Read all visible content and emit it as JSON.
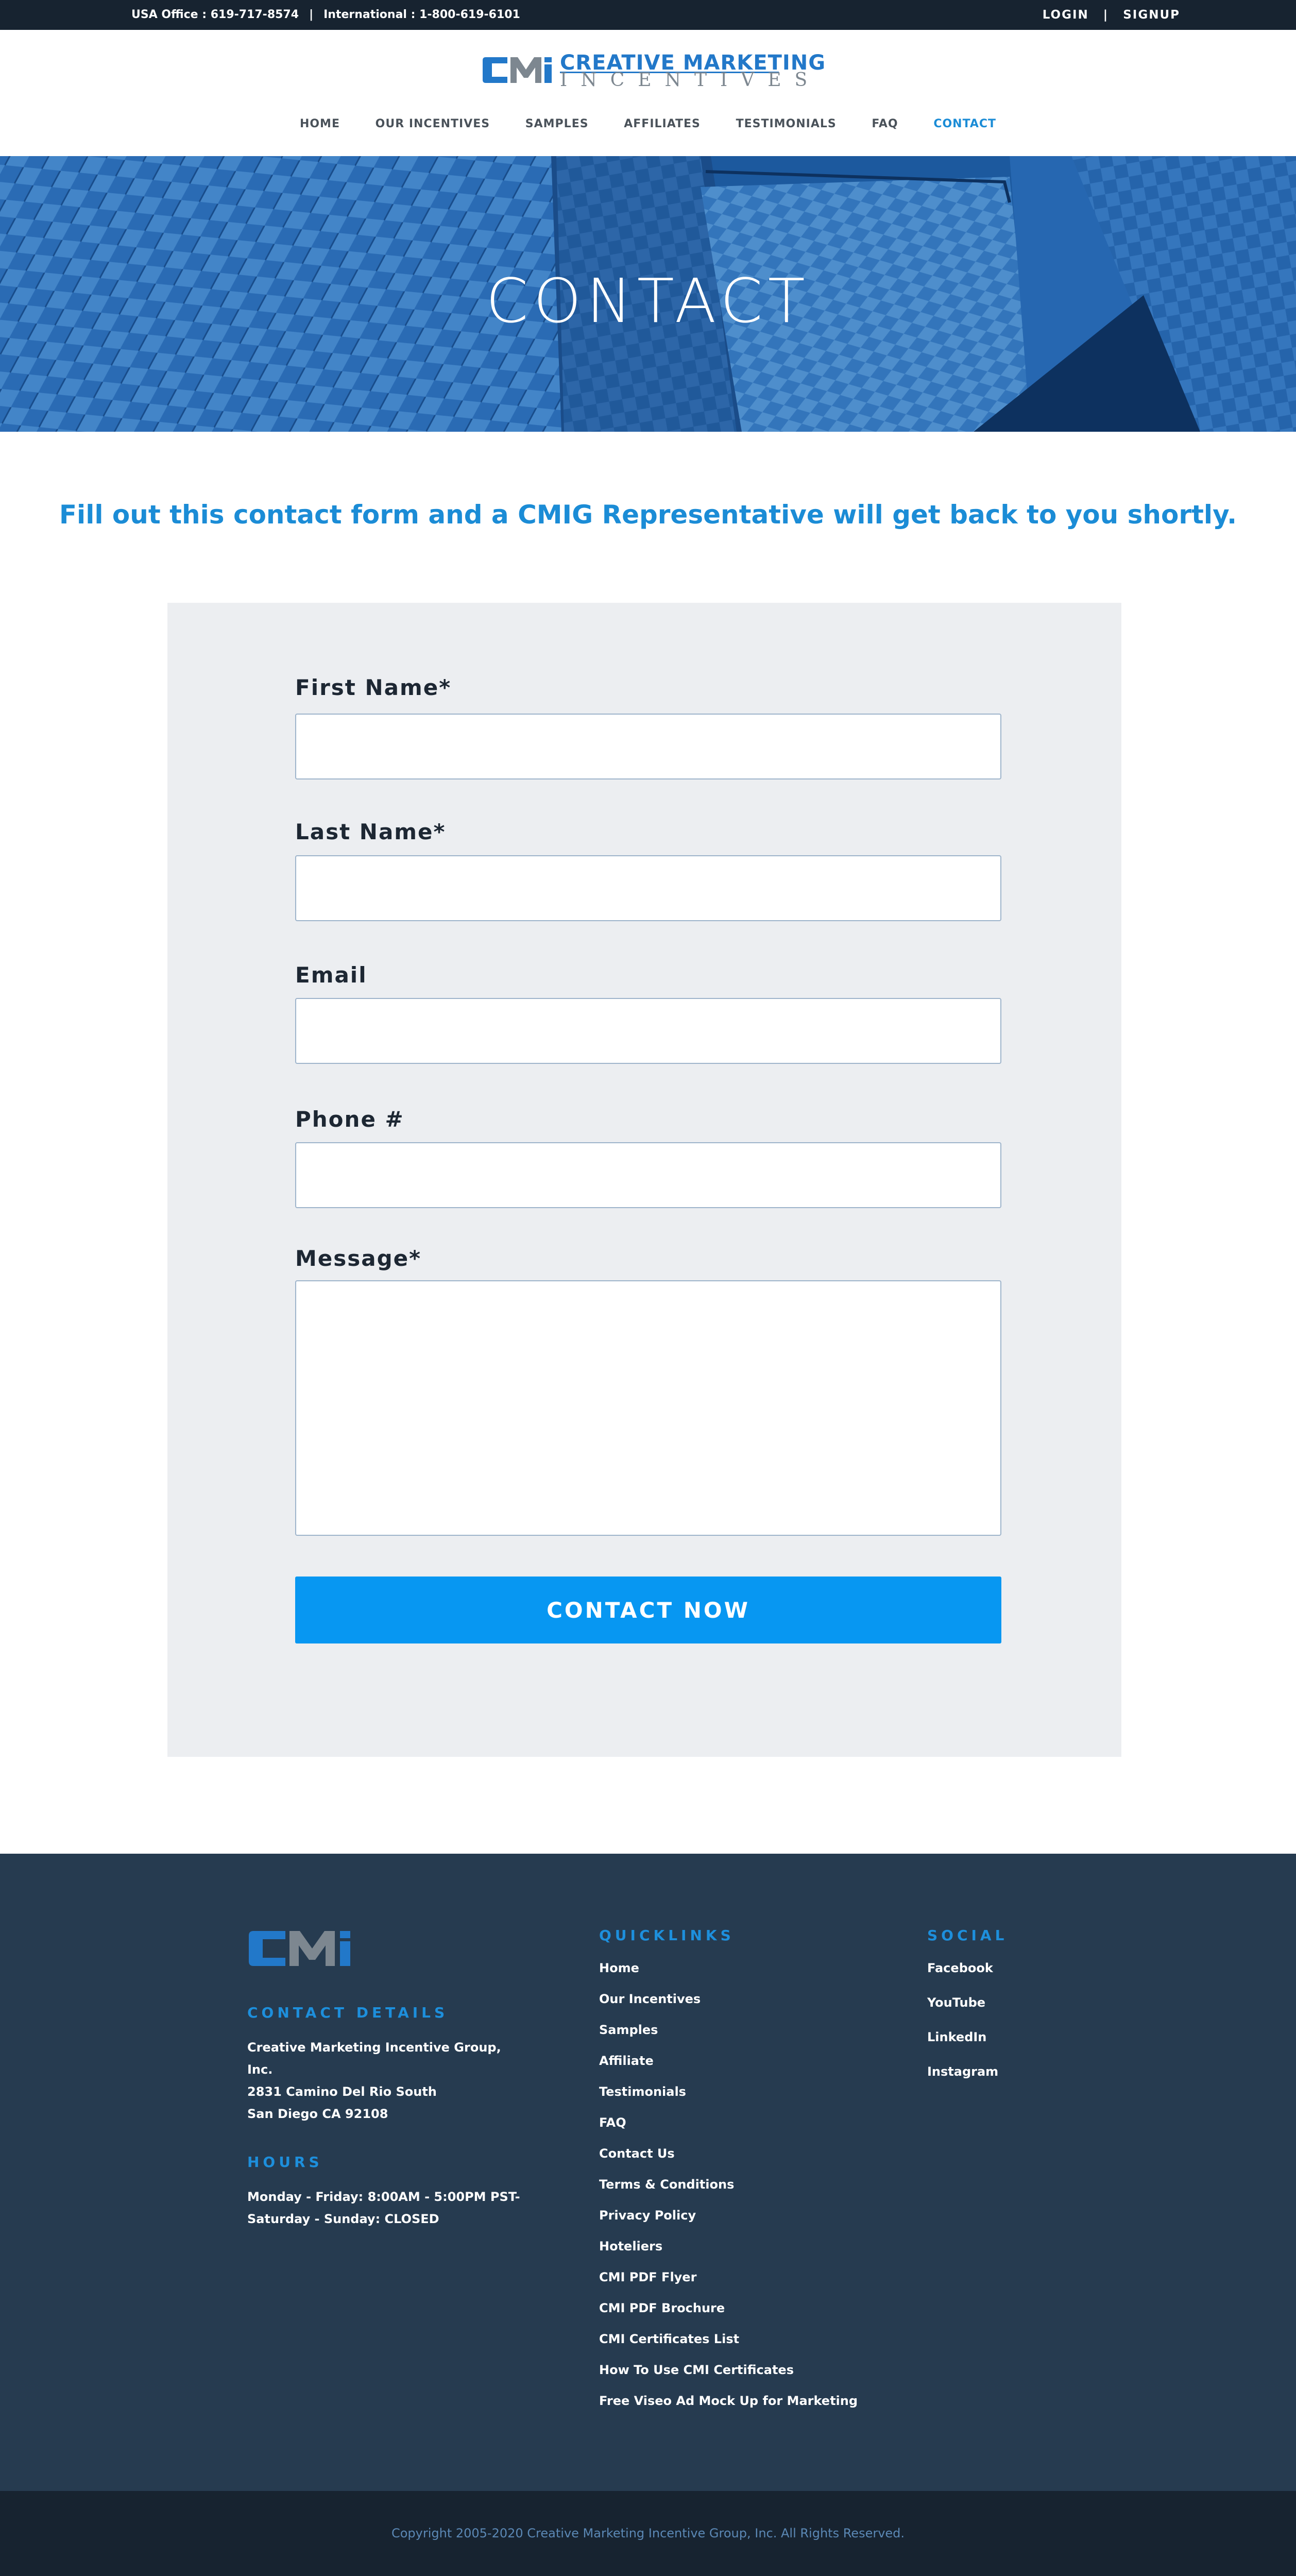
{
  "topbar": {
    "usa_office": "USA Office : 619-717-8574",
    "separator": "|",
    "international": "International : 1-800-619-6101",
    "login": "LOGIN",
    "signup": "SIGNUP"
  },
  "brand": {
    "logo_top": "CREATIVE MARKETING",
    "logo_bottom": "INCENTIVES",
    "primary_color": "#2278c9",
    "accent_color": "#1b8cd6"
  },
  "nav": {
    "items": [
      {
        "label": "HOME"
      },
      {
        "label": "OUR INCENTIVES"
      },
      {
        "label": "SAMPLES"
      },
      {
        "label": "AFFILIATES"
      },
      {
        "label": "TESTIMONIALS"
      },
      {
        "label": "FAQ"
      },
      {
        "label": "CONTACT",
        "active": true
      }
    ]
  },
  "hero": {
    "title": "CONTACT"
  },
  "intro": "Fill out this contact form and a CMIG Representative will get back to you shortly.",
  "form": {
    "first_name_label": "First Name*",
    "first_name_value": "",
    "last_name_label": "Last Name*",
    "last_name_value": "",
    "email_label": "Email",
    "email_value": "",
    "phone_label": "Phone #",
    "phone_value": "",
    "message_label": "Message*",
    "message_value": "",
    "submit_label": "CONTACT NOW"
  },
  "footer": {
    "contact_heading": "CONTACT DETAILS",
    "company_line1": "Creative Marketing Incentive Group,",
    "company_line2": "Inc.",
    "address_line1": "2831 Camino Del Rio South",
    "address_line2": "San Diego CA 92108",
    "hours_heading": "HOURS",
    "hours_weekday": "Monday - Friday: 8:00AM - 5:00PM PST-",
    "hours_weekend": "Saturday - Sunday: CLOSED",
    "quicklinks_heading": "QUICKLINKS",
    "quicklinks": [
      "Home",
      "Our Incentives",
      "Samples",
      "Affiliate",
      "Testimonials",
      "FAQ",
      "Contact Us",
      "Terms & Conditions",
      "Privacy Policy",
      "Hoteliers",
      "CMI PDF Flyer",
      "CMI PDF Brochure",
      "CMI Certificates List",
      "How To Use CMI Certificates",
      "Free Viseo Ad Mock Up for Marketing"
    ],
    "social_heading": "SOCIAL",
    "social": [
      "Facebook",
      "YouTube",
      "LinkedIn",
      "Instagram"
    ]
  },
  "copyright": "Copyright 2005-2020 Creative Marketing Incentive Group, Inc. All Rights Reserved."
}
